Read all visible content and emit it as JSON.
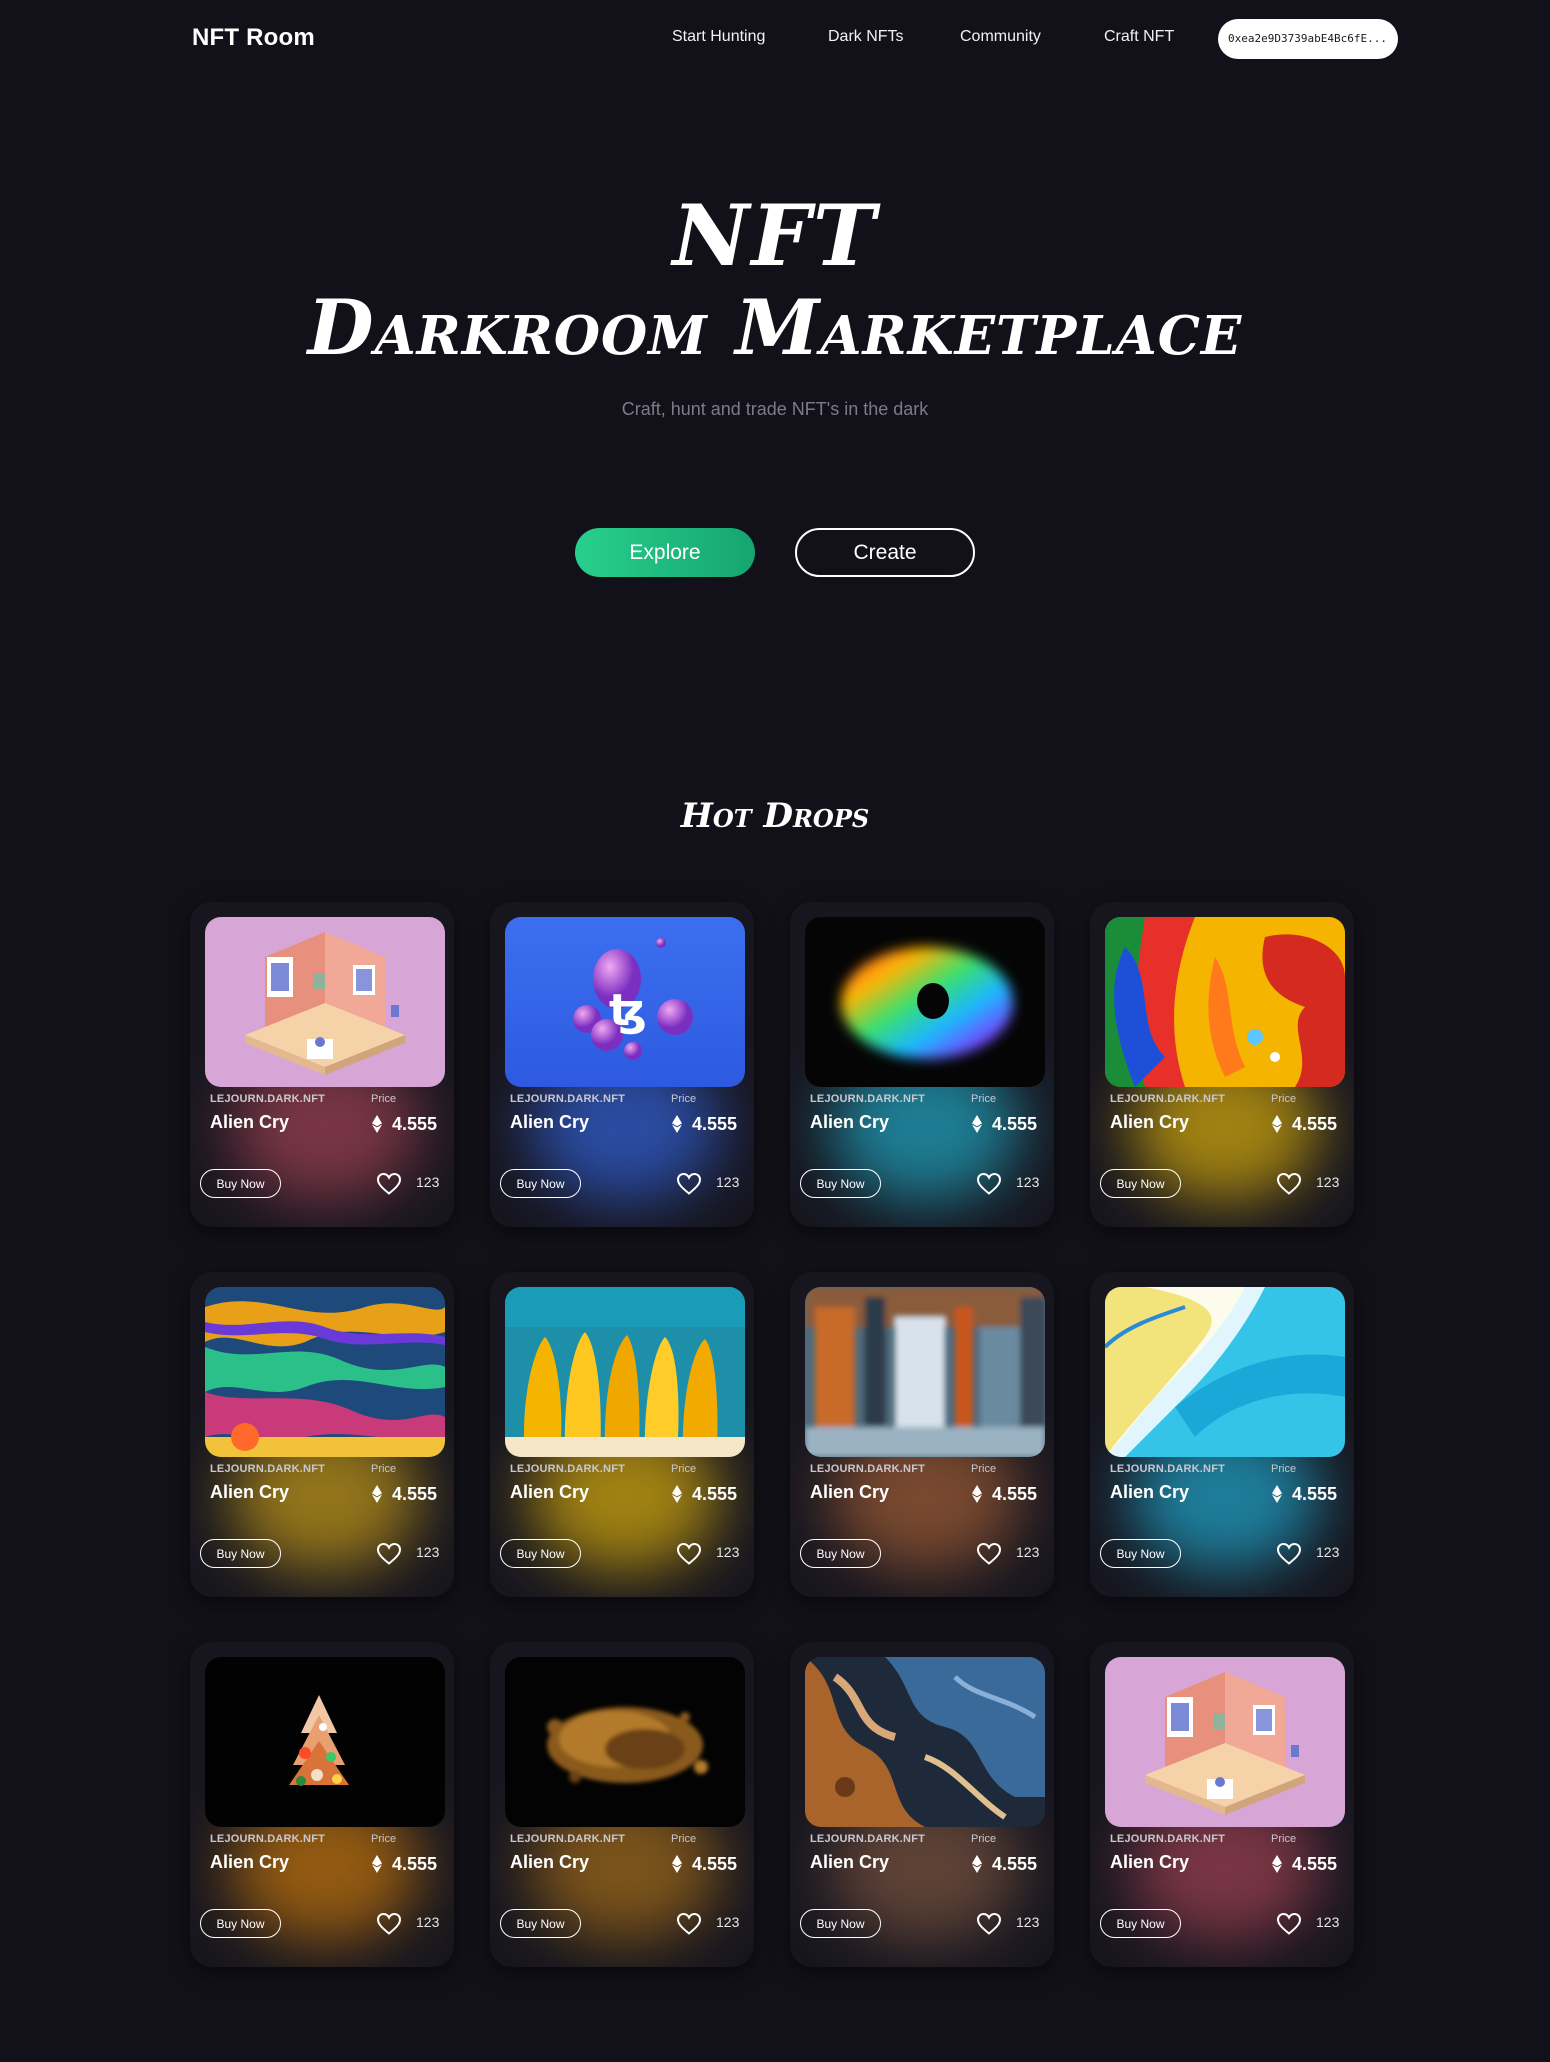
{
  "nav": {
    "brand": "NFT Room",
    "links": [
      "Start Hunting",
      "Dark NFTs",
      "Community",
      "Craft NFT"
    ],
    "wallet": "0xea2e9D3739abE4Bc6fE..."
  },
  "hero": {
    "title_line1": "NFT",
    "title_line2": "Darkroom Marketplace",
    "subtitle": "Craft, hunt and trade NFT's in the dark",
    "explore_label": "Explore",
    "create_label": "Create"
  },
  "hot_drops": {
    "title": "Hot Drops",
    "cards": [
      {
        "creator": "LEJOURN.DARK.NFT",
        "price_label": "Price",
        "name": "Alien Cry",
        "price": "4.555",
        "buy_label": "Buy Now",
        "likes": "123",
        "art": "isometric-room",
        "glow": "#8a3b4a"
      },
      {
        "creator": "LEJOURN.DARK.NFT",
        "price_label": "Price",
        "name": "Alien Cry",
        "price": "4.555",
        "buy_label": "Buy Now",
        "likes": "123",
        "art": "tezos-spheres",
        "glow": "#2e55b8"
      },
      {
        "creator": "LEJOURN.DARK.NFT",
        "price_label": "Price",
        "name": "Alien Cry",
        "price": "4.555",
        "buy_label": "Buy Now",
        "likes": "123",
        "art": "rainbow-ring",
        "glow": "#1f8fa8"
      },
      {
        "creator": "LEJOURN.DARK.NFT",
        "price_label": "Price",
        "name": "Alien Cry",
        "price": "4.555",
        "buy_label": "Buy Now",
        "likes": "123",
        "art": "paint-splash",
        "glow": "#b8940f"
      },
      {
        "creator": "LEJOURN.DARK.NFT",
        "price_label": "Price",
        "name": "Alien Cry",
        "price": "4.555",
        "buy_label": "Buy Now",
        "likes": "123",
        "art": "oil-swirl",
        "glow": "#a8851a"
      },
      {
        "creator": "LEJOURN.DARK.NFT",
        "price_label": "Price",
        "name": "Alien Cry",
        "price": "4.555",
        "buy_label": "Buy Now",
        "likes": "123",
        "art": "yellow-drips",
        "glow": "#b89410"
      },
      {
        "creator": "LEJOURN.DARK.NFT",
        "price_label": "Price",
        "name": "Alien Cry",
        "price": "4.555",
        "buy_label": "Buy Now",
        "likes": "123",
        "art": "abstract-forest",
        "glow": "#8a5232"
      },
      {
        "creator": "LEJOURN.DARK.NFT",
        "price_label": "Price",
        "name": "Alien Cry",
        "price": "4.555",
        "buy_label": "Buy Now",
        "likes": "123",
        "art": "blue-wave",
        "glow": "#1f8fb0"
      },
      {
        "creator": "LEJOURN.DARK.NFT",
        "price_label": "Price",
        "name": "Alien Cry",
        "price": "4.555",
        "buy_label": "Buy Now",
        "likes": "123",
        "art": "cone-tree",
        "glow": "#a8660f"
      },
      {
        "creator": "LEJOURN.DARK.NFT",
        "price_label": "Price",
        "name": "Alien Cry",
        "price": "4.555",
        "buy_label": "Buy Now",
        "likes": "123",
        "art": "gold-splash",
        "glow": "#8c5e1a"
      },
      {
        "creator": "LEJOURN.DARK.NFT",
        "price_label": "Price",
        "name": "Alien Cry",
        "price": "4.555",
        "buy_label": "Buy Now",
        "likes": "123",
        "art": "marble-flow",
        "glow": "#6a4a3a"
      },
      {
        "creator": "LEJOURN.DARK.NFT",
        "price_label": "Price",
        "name": "Alien Cry",
        "price": "4.555",
        "buy_label": "Buy Now",
        "likes": "123",
        "art": "isometric-room",
        "glow": "#8a3b4a"
      }
    ]
  },
  "colors": {
    "background": "#121119",
    "card": "#17161f",
    "accent_start": "#28cf8c",
    "accent_end": "#15a56f",
    "subtitle": "#7d7c86"
  }
}
